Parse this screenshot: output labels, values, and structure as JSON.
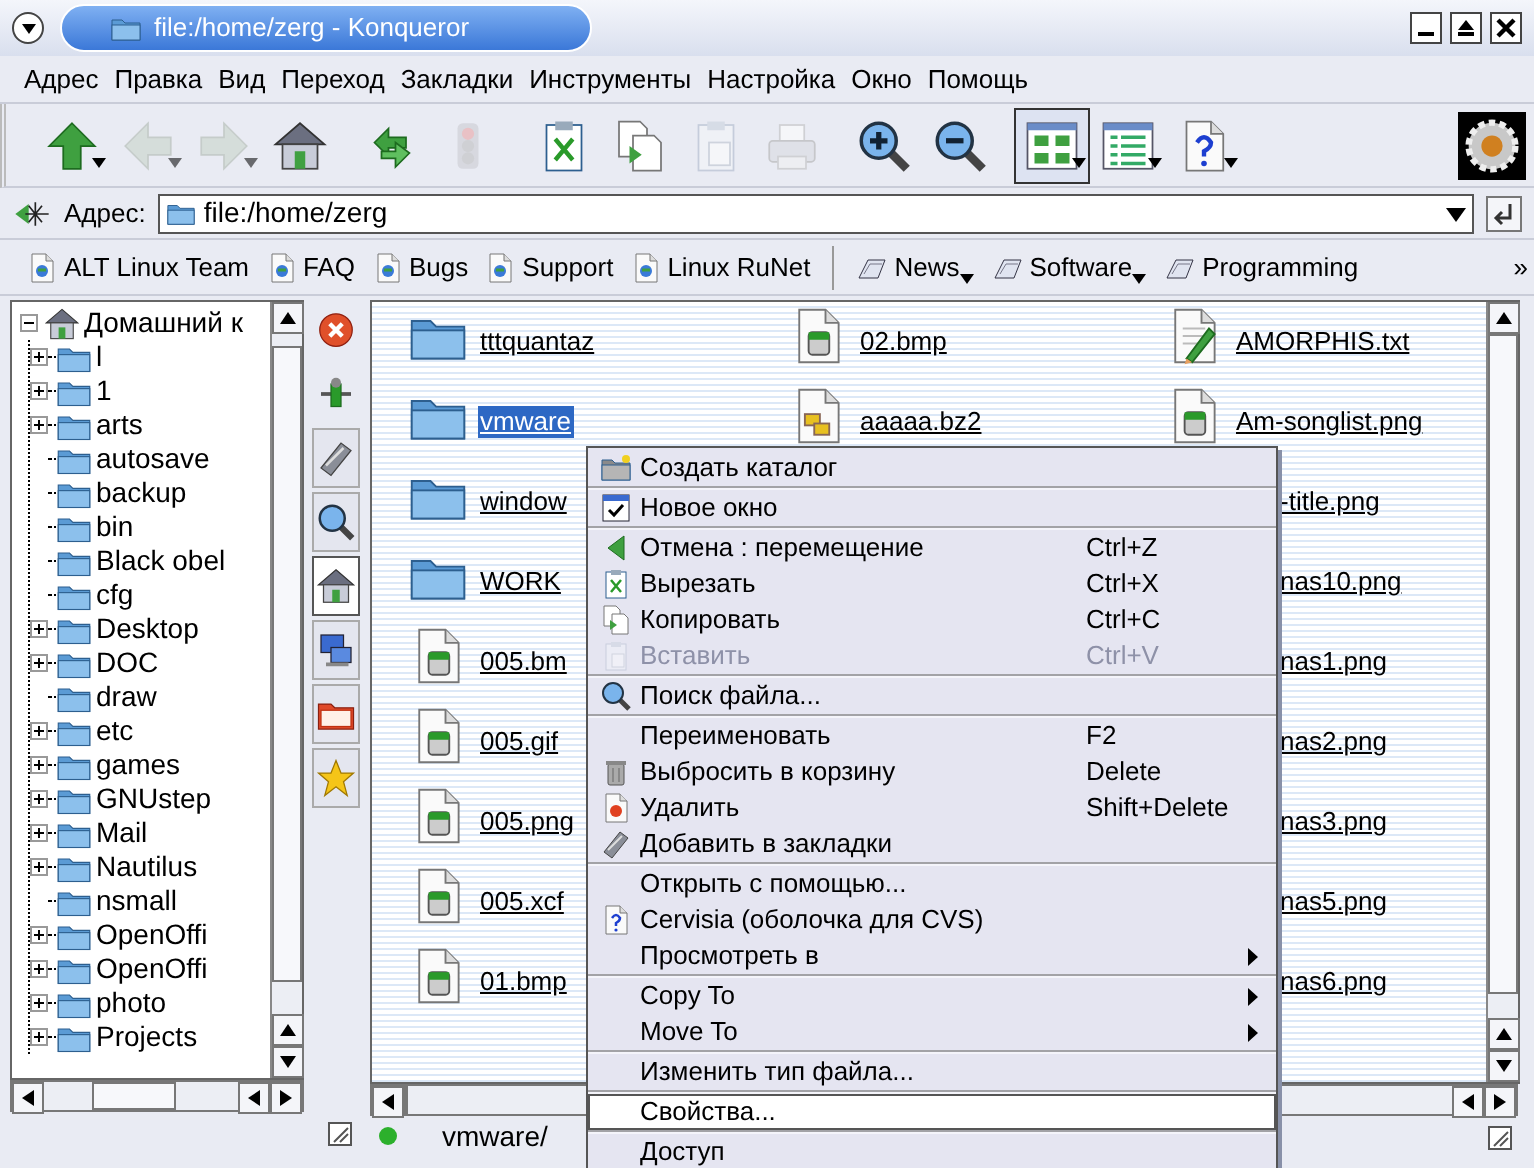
{
  "window": {
    "title": "file:/home/zerg - Konqueror"
  },
  "menubar": [
    "Адрес",
    "Правка",
    "Вид",
    "Переход",
    "Закладки",
    "Инструменты",
    "Настройка",
    "Окно",
    "Помощь"
  ],
  "toolbar": [
    {
      "kind": "up",
      "disabled": false,
      "dropdown": true,
      "selected": false
    },
    {
      "kind": "back",
      "disabled": true,
      "dropdown": true,
      "selected": false
    },
    {
      "kind": "forward",
      "disabled": true,
      "dropdown": true,
      "selected": false
    },
    {
      "kind": "home",
      "disabled": false,
      "dropdown": false,
      "selected": false
    },
    {
      "kind": "reload",
      "disabled": false,
      "dropdown": false,
      "selected": false
    },
    {
      "kind": "stop",
      "disabled": true,
      "dropdown": false,
      "selected": false
    },
    {
      "kind": "cut",
      "disabled": false,
      "dropdown": false,
      "selected": false
    },
    {
      "kind": "copy",
      "disabled": false,
      "dropdown": false,
      "selected": false
    },
    {
      "kind": "paste",
      "disabled": true,
      "dropdown": false,
      "selected": false
    },
    {
      "kind": "print",
      "disabled": true,
      "dropdown": false,
      "selected": false
    },
    {
      "kind": "zoom-in",
      "disabled": false,
      "dropdown": false,
      "selected": false
    },
    {
      "kind": "zoom-out",
      "disabled": false,
      "dropdown": false,
      "selected": false
    },
    {
      "kind": "icon-view",
      "disabled": false,
      "dropdown": true,
      "selected": true
    },
    {
      "kind": "detail-view",
      "disabled": false,
      "dropdown": true,
      "selected": false
    },
    {
      "kind": "help",
      "disabled": false,
      "dropdown": true,
      "selected": false
    }
  ],
  "location": {
    "label": "Адрес:",
    "value": "file:/home/zerg"
  },
  "bookmarks": [
    {
      "kind": "page",
      "label": "ALT Linux Team",
      "dropdown": false
    },
    {
      "kind": "page",
      "label": "FAQ",
      "dropdown": false
    },
    {
      "kind": "page",
      "label": "Bugs",
      "dropdown": false
    },
    {
      "kind": "page",
      "label": "Support",
      "dropdown": false
    },
    {
      "kind": "page",
      "label": "Linux RuNet",
      "dropdown": false
    },
    {
      "kind": "folder",
      "label": "News",
      "dropdown": true
    },
    {
      "kind": "folder",
      "label": "Software",
      "dropdown": true
    },
    {
      "kind": "folder",
      "label": "Programming",
      "dropdown": false
    }
  ],
  "bookmarks_more": "»",
  "tree": {
    "label": "Домашний к",
    "expanded": true,
    "children": [
      {
        "label": "l",
        "kind": "branch"
      },
      {
        "label": "1",
        "kind": "branch"
      },
      {
        "label": "arts",
        "kind": "branch"
      },
      {
        "label": "autosave",
        "kind": "leaf"
      },
      {
        "label": "backup",
        "kind": "leaf"
      },
      {
        "label": "bin",
        "kind": "leaf"
      },
      {
        "label": "Black obel",
        "kind": "leaf"
      },
      {
        "label": "cfg",
        "kind": "leaf"
      },
      {
        "label": "Desktop",
        "kind": "branch"
      },
      {
        "label": "DOC",
        "kind": "branch"
      },
      {
        "label": "draw",
        "kind": "leaf"
      },
      {
        "label": "etc",
        "kind": "branch"
      },
      {
        "label": "games",
        "kind": "branch"
      },
      {
        "label": "GNUstep",
        "kind": "branch"
      },
      {
        "label": "Mail",
        "kind": "branch"
      },
      {
        "label": "Nautilus",
        "kind": "branch"
      },
      {
        "label": "nsmall",
        "kind": "leaf"
      },
      {
        "label": "OpenOffi",
        "kind": "branch"
      },
      {
        "label": "OpenOffi",
        "kind": "branch"
      },
      {
        "label": "photo",
        "kind": "branch"
      },
      {
        "label": "Projects",
        "kind": "branch"
      }
    ]
  },
  "side_tabs": [
    {
      "kind": "bookmarks",
      "selected": false
    },
    {
      "kind": "search",
      "selected": false
    },
    {
      "kind": "home",
      "selected": true
    },
    {
      "kind": "network",
      "selected": false
    },
    {
      "kind": "folder",
      "selected": false
    },
    {
      "kind": "star",
      "selected": false
    }
  ],
  "files": {
    "columns": [
      [
        {
          "name": "tttquantaz",
          "kind": "folder",
          "selected": false
        },
        {
          "name": "vmware",
          "kind": "folder",
          "selected": true
        },
        {
          "name": "window",
          "kind": "folder",
          "selected": false
        },
        {
          "name": "WORK",
          "kind": "folder",
          "selected": false
        },
        {
          "name": "005.bm",
          "kind": "image",
          "selected": false
        },
        {
          "name": "005.gif",
          "kind": "image",
          "selected": false
        },
        {
          "name": "005.png",
          "kind": "image",
          "selected": false
        },
        {
          "name": "005.xcf",
          "kind": "image",
          "selected": false
        },
        {
          "name": "01.bmp",
          "kind": "image",
          "selected": false
        }
      ],
      [
        {
          "name": "02.bmp",
          "kind": "image",
          "selected": false
        },
        {
          "name": "aaaaa.bz2",
          "kind": "archive",
          "selected": false
        }
      ],
      [
        {
          "name": "AMORPHIS.txt",
          "kind": "text",
          "selected": false
        },
        {
          "name": "Am-songlist.png",
          "kind": "image",
          "selected": false
        },
        {
          "name": "-title.png",
          "kind": "covered",
          "selected": false
        },
        {
          "name": "nas10.png",
          "kind": "covered",
          "selected": false
        },
        {
          "name": "nas1.png",
          "kind": "covered",
          "selected": false
        },
        {
          "name": "nas2.png",
          "kind": "covered",
          "selected": false
        },
        {
          "name": "nas3.png",
          "kind": "covered",
          "selected": false
        },
        {
          "name": "nas5.png",
          "kind": "covered",
          "selected": false
        },
        {
          "name": "nas6.png",
          "kind": "covered",
          "selected": false
        }
      ]
    ]
  },
  "context_menu": {
    "groups": [
      [
        {
          "label": "Создать каталог",
          "kind": "new-folder",
          "disabled": false,
          "submenu": false,
          "selected": false
        }
      ],
      [
        {
          "label": "Новое окно",
          "kind": "new-window",
          "disabled": false,
          "submenu": false,
          "selected": false
        }
      ],
      [
        {
          "label": "Отмена : перемещение",
          "shortcut": "Ctrl+Z",
          "kind": "undo",
          "disabled": false,
          "submenu": false,
          "selected": false
        },
        {
          "label": "Вырезать",
          "shortcut": "Ctrl+X",
          "kind": "cut",
          "disabled": false,
          "submenu": false,
          "selected": false
        },
        {
          "label": "Копировать",
          "shortcut": "Ctrl+C",
          "kind": "copy",
          "disabled": false,
          "submenu": false,
          "selected": false
        },
        {
          "label": "Вставить",
          "shortcut": "Ctrl+V",
          "kind": "paste",
          "disabled": true,
          "submenu": false,
          "selected": false
        }
      ],
      [
        {
          "label": "Поиск файла...",
          "kind": "search",
          "disabled": false,
          "submenu": false,
          "selected": false
        }
      ],
      [
        {
          "label": "Переименовать",
          "shortcut": "F2",
          "kind": "none",
          "disabled": false,
          "submenu": false,
          "selected": false
        },
        {
          "label": "Выбросить в корзину",
          "shortcut": "Delete",
          "kind": "trash",
          "disabled": false,
          "submenu": false,
          "selected": false
        },
        {
          "label": "Удалить",
          "shortcut": "Shift+Delete",
          "kind": "delete",
          "disabled": false,
          "submenu": false,
          "selected": false
        },
        {
          "label": "Добавить в закладки",
          "kind": "bookmark",
          "disabled": false,
          "submenu": false,
          "selected": false
        }
      ],
      [
        {
          "label": "Открыть с помощью...",
          "kind": "none",
          "disabled": false,
          "submenu": false,
          "selected": false
        },
        {
          "label": "Cervisia (оболочка для CVS)",
          "kind": "help",
          "disabled": false,
          "submenu": false,
          "selected": false
        },
        {
          "label": "Просмотреть в",
          "kind": "none",
          "disabled": false,
          "submenu": true,
          "selected": false
        }
      ],
      [
        {
          "label": "Copy To",
          "kind": "none",
          "disabled": false,
          "submenu": true,
          "selected": false
        },
        {
          "label": "Move To",
          "kind": "none",
          "disabled": false,
          "submenu": true,
          "selected": false
        }
      ],
      [
        {
          "label": "Изменить тип файла...",
          "kind": "none",
          "disabled": false,
          "submenu": false,
          "selected": false
        }
      ],
      [
        {
          "label": "Свойства...",
          "kind": "none",
          "disabled": false,
          "submenu": false,
          "selected": true
        }
      ],
      [
        {
          "label": "Доступ",
          "kind": "none",
          "disabled": false,
          "submenu": false,
          "selected": false
        }
      ]
    ]
  },
  "status_bar": {
    "text": "vmware/"
  }
}
